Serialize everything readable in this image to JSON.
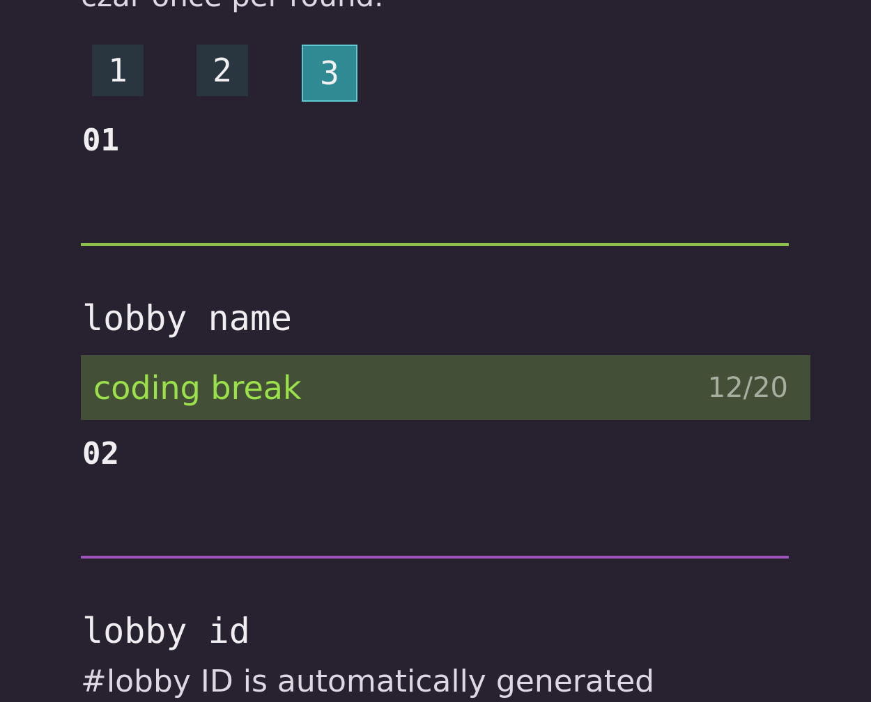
{
  "description_tail": "czar once per round.",
  "options": [
    {
      "label": "1",
      "selected": false
    },
    {
      "label": "2",
      "selected": false
    },
    {
      "label": "3",
      "selected": true
    }
  ],
  "sections": [
    {
      "number": "01",
      "divider_color": "#8bc34a"
    },
    {
      "number": "02",
      "divider_color": "#9a57b7"
    }
  ],
  "lobby_name": {
    "label": "lobby name",
    "value": "coding break",
    "counter": "12/20"
  },
  "lobby_id": {
    "label": "lobby id",
    "description": "#lobby ID is automatically generated"
  },
  "colors": {
    "background": "#272130",
    "field_background": "#434f37",
    "field_text": "#9be24a",
    "selected_option": "#2f8a93",
    "unselected_option": "#293640"
  }
}
